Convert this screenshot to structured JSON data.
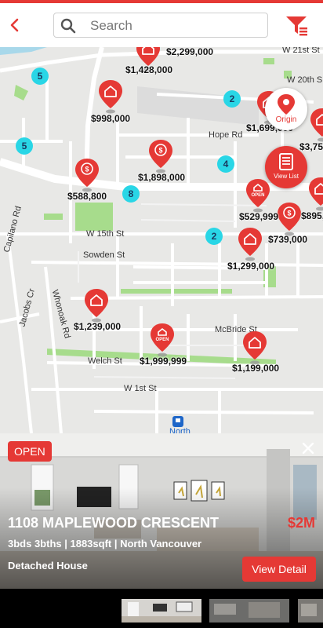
{
  "header": {
    "search_placeholder": "Search",
    "back_icon": "chevron-left-icon",
    "filter_icon": "filter-icon"
  },
  "colors": {
    "accent": "#e53935",
    "cluster": "#29d6e6",
    "park": "#a7dc8c",
    "map_bg": "#e8e8e6"
  },
  "map": {
    "streets": [
      "W 21st St",
      "W 20th S",
      "Hope Rd",
      "W 15th St",
      "Sowden St",
      "McBride St",
      "Welch St",
      "W 1st St",
      "Capilano Rd",
      "Jacobs Cr",
      "Whonoak Rd",
      "North"
    ],
    "clusters": [
      "5",
      "5",
      "8",
      "2",
      "4",
      "2"
    ],
    "listings": [
      {
        "price": "$2,299,000",
        "open": false,
        "sold": false
      },
      {
        "price": "$1,428,000",
        "open": false,
        "sold": false
      },
      {
        "price": "$998,000",
        "open": false,
        "sold": false
      },
      {
        "price": "$1,699,000",
        "open": false,
        "sold": false
      },
      {
        "price": "$3,75",
        "open": false,
        "sold": false
      },
      {
        "price": "$1,898,000",
        "open": false,
        "sold": true
      },
      {
        "price": "$588,800",
        "open": false,
        "sold": true
      },
      {
        "price": "$529,999",
        "open": true,
        "sold": false
      },
      {
        "price": "$895,",
        "open": false,
        "sold": false
      },
      {
        "price": "$739,000",
        "open": false,
        "sold": true
      },
      {
        "price": "$1,299,000",
        "open": false,
        "sold": false
      },
      {
        "price": "$1,239,000",
        "open": false,
        "sold": false
      },
      {
        "price": "$1,999,999",
        "open": true,
        "sold": false
      },
      {
        "price": "$1,199,000",
        "open": false,
        "sold": false
      }
    ],
    "pin_open_label": "OPEN",
    "origin_label": "Origin",
    "origin_icon": "location-pin-icon",
    "view_list_label": "View List",
    "view_list_icon": "list-icon"
  },
  "card": {
    "badge": "OPEN",
    "address": "1108 MAPLEWOOD CRESCENT",
    "price": "$2M",
    "details": "3bds 3bths | 1883sqft | North Vancouver",
    "property_type": "Detached House",
    "view_detail_label": "View Detail",
    "close_icon": "close-icon"
  },
  "thumbnails": [
    "thumbnail-1",
    "thumbnail-2",
    "thumbnail-3"
  ]
}
